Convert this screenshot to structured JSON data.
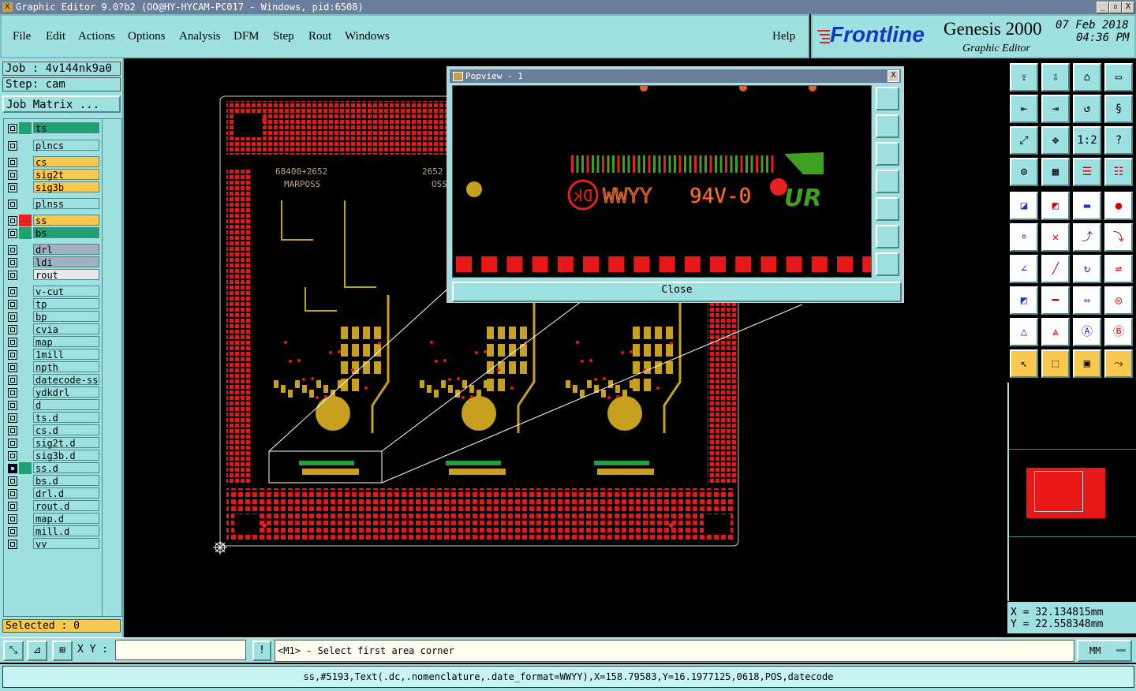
{
  "window": {
    "title": "Graphic Editor 9.0?b2 (OO@HY-HYCAM-PC017 - Windows, pid:6508)",
    "controls": [
      "_",
      "▫",
      "X"
    ]
  },
  "menu": {
    "items": [
      "File",
      "Edit",
      "Actions",
      "Options",
      "Analysis",
      "DFM",
      "Step",
      "Rout",
      "Windows"
    ],
    "help": "Help"
  },
  "brand": {
    "logo": "Frontline",
    "product": "Genesis 2000",
    "subtitle": "Graphic Editor",
    "date": "07 Feb 2018",
    "time": "04:36 PM"
  },
  "job": {
    "job_line": "Job : 4v144nk9a0",
    "step_line": "Step: cam",
    "matrix_button": "Job Matrix ..."
  },
  "layers": [
    {
      "name": "ts",
      "color": "#20a070",
      "swatch": "#20a070"
    },
    {
      "name": "plncs",
      "color": "#9fe0e0",
      "swatch": "#9fe0e0"
    },
    {
      "name": "cs",
      "color": "#f8c850",
      "swatch": "#9fe0e0"
    },
    {
      "name": "sig2t",
      "color": "#f8c850",
      "swatch": "#9fe0e0"
    },
    {
      "name": "sig3b",
      "color": "#f8c850",
      "swatch": "#9fe0e0"
    },
    {
      "name": "plnss",
      "color": "#9fe0e0",
      "swatch": "#9fe0e0"
    },
    {
      "name": "ss",
      "color": "#f8c850",
      "swatch": "#e82020"
    },
    {
      "name": "bs",
      "color": "#20a070",
      "swatch": "#20a070"
    },
    {
      "name": "drl",
      "color": "#a0b0c0",
      "swatch": "#9fe0e0"
    },
    {
      "name": "ldi",
      "color": "#a0b0c0",
      "swatch": "#9fe0e0"
    },
    {
      "name": "rout",
      "color": "#e8e8e8",
      "swatch": "#9fe0e0"
    },
    {
      "name": "v-cut",
      "color": "#9fe0e0",
      "swatch": "#9fe0e0"
    },
    {
      "name": "tp",
      "color": "#9fe0e0",
      "swatch": "#9fe0e0"
    },
    {
      "name": "bp",
      "color": "#9fe0e0",
      "swatch": "#9fe0e0"
    },
    {
      "name": "cvia",
      "color": "#9fe0e0",
      "swatch": "#9fe0e0"
    },
    {
      "name": "map",
      "color": "#9fe0e0",
      "swatch": "#9fe0e0"
    },
    {
      "name": "1mill",
      "color": "#9fe0e0",
      "swatch": "#9fe0e0"
    },
    {
      "name": "npth",
      "color": "#9fe0e0",
      "swatch": "#9fe0e0"
    },
    {
      "name": "datecode-ss",
      "color": "#9fe0e0",
      "swatch": "#9fe0e0"
    },
    {
      "name": "ydkdrl",
      "color": "#9fe0e0",
      "swatch": "#9fe0e0"
    },
    {
      "name": "d",
      "color": "#9fe0e0",
      "swatch": "#9fe0e0"
    },
    {
      "name": "ts.d",
      "color": "#9fe0e0",
      "swatch": "#9fe0e0"
    },
    {
      "name": "cs.d",
      "color": "#9fe0e0",
      "swatch": "#9fe0e0"
    },
    {
      "name": "sig2t.d",
      "color": "#9fe0e0",
      "swatch": "#9fe0e0"
    },
    {
      "name": "sig3b.d",
      "color": "#9fe0e0",
      "swatch": "#9fe0e0"
    },
    {
      "name": "ss.d",
      "color": "#9fe0e0",
      "swatch": "#20a070"
    },
    {
      "name": "bs.d",
      "color": "#9fe0e0",
      "swatch": "#9fe0e0"
    },
    {
      "name": "drl.d",
      "color": "#9fe0e0",
      "swatch": "#9fe0e0"
    },
    {
      "name": "rout.d",
      "color": "#9fe0e0",
      "swatch": "#9fe0e0"
    },
    {
      "name": "map.d",
      "color": "#9fe0e0",
      "swatch": "#9fe0e0"
    },
    {
      "name": "mill.d",
      "color": "#9fe0e0",
      "swatch": "#9fe0e0"
    },
    {
      "name": "vv",
      "color": "#9fe0e0",
      "swatch": "#9fe0e0"
    }
  ],
  "selected": "Selected : 0",
  "coords": {
    "x": "X = 32.134815mm",
    "y": "Y = 22.558348mm"
  },
  "bottom": {
    "xy_label": "X Y :",
    "xy_value": "",
    "prompt": "<M1> - Select first area corner",
    "units": "MM"
  },
  "status_line": "ss,#5193,Text(.dc,.nomenclature,.date_format=WWYY),X=158.79583,Y=16.1977125,0618,POS,datecode",
  "popup": {
    "title": "Popview - 1",
    "close_label": "Close",
    "text_94v0": "94V-0",
    "text_date": "WWYY",
    "text_logo": "UR"
  },
  "board": {
    "silk_top_left": "68400+2652",
    "silk_sub_left": "MARPOSS",
    "silk_top_mid": "2652",
    "silk_sub_mid": "OSS"
  },
  "colors": {
    "panel": "#9fe0e0",
    "pads": "#e81818",
    "copper": "#c8a020",
    "silk": "#20a040"
  }
}
